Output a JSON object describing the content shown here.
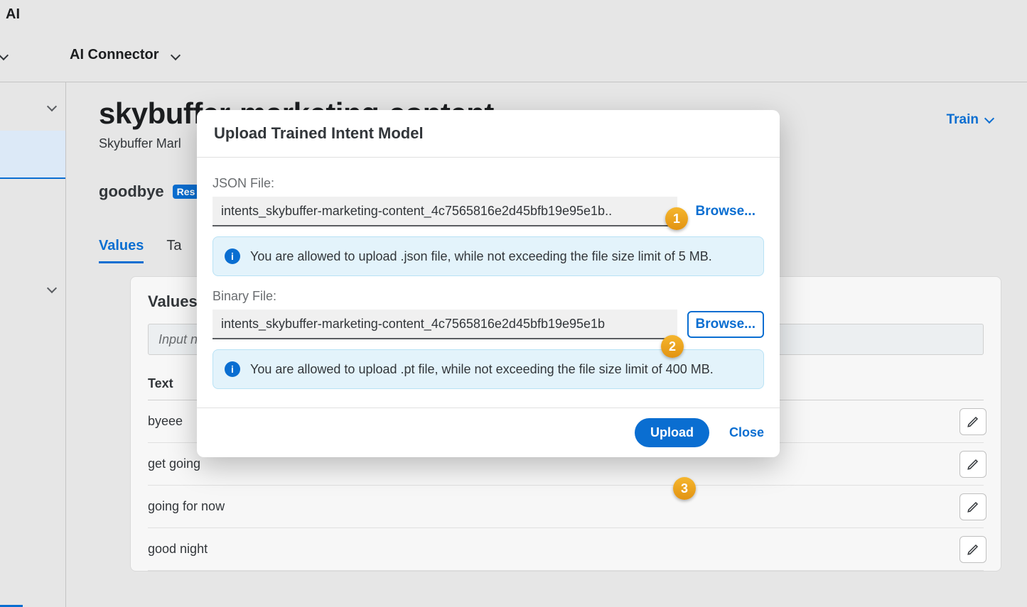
{
  "topbar": {
    "product_suffix": "AI"
  },
  "nav": {
    "ai_connector": "AI Connector"
  },
  "train_button": "Train",
  "page": {
    "title_truncated": "skybuffer-marketing-content",
    "subtitle_truncated": "Skybuffer Marl",
    "intent_name": "goodbye",
    "restricted_badge": "Res"
  },
  "tabs": {
    "values": "Values",
    "tags_truncated": "Ta"
  },
  "valuesbox": {
    "heading": "Values",
    "search_placeholder": "Input n",
    "column_header": "Text",
    "rows": [
      "byeee",
      "get going",
      "going for now",
      "good night"
    ]
  },
  "dialog": {
    "title": "Upload Trained Intent Model",
    "json_label": "JSON File:",
    "json_filename": "intents_skybuffer-marketing-content_4c7565816e2d45bfb19e95e1b..",
    "json_info": "You are allowed to upload .json file, while not exceeding the file size limit of 5 MB.",
    "binary_label": "Binary File:",
    "binary_filename": "intents_skybuffer-marketing-content_4c7565816e2d45bfb19e95e1b",
    "binary_info": "You are allowed to upload .pt file, while not exceeding the file size limit of 400 MB.",
    "browse": "Browse...",
    "upload": "Upload",
    "close": "Close"
  },
  "callouts": {
    "1": "1",
    "2": "2",
    "3": "3"
  }
}
